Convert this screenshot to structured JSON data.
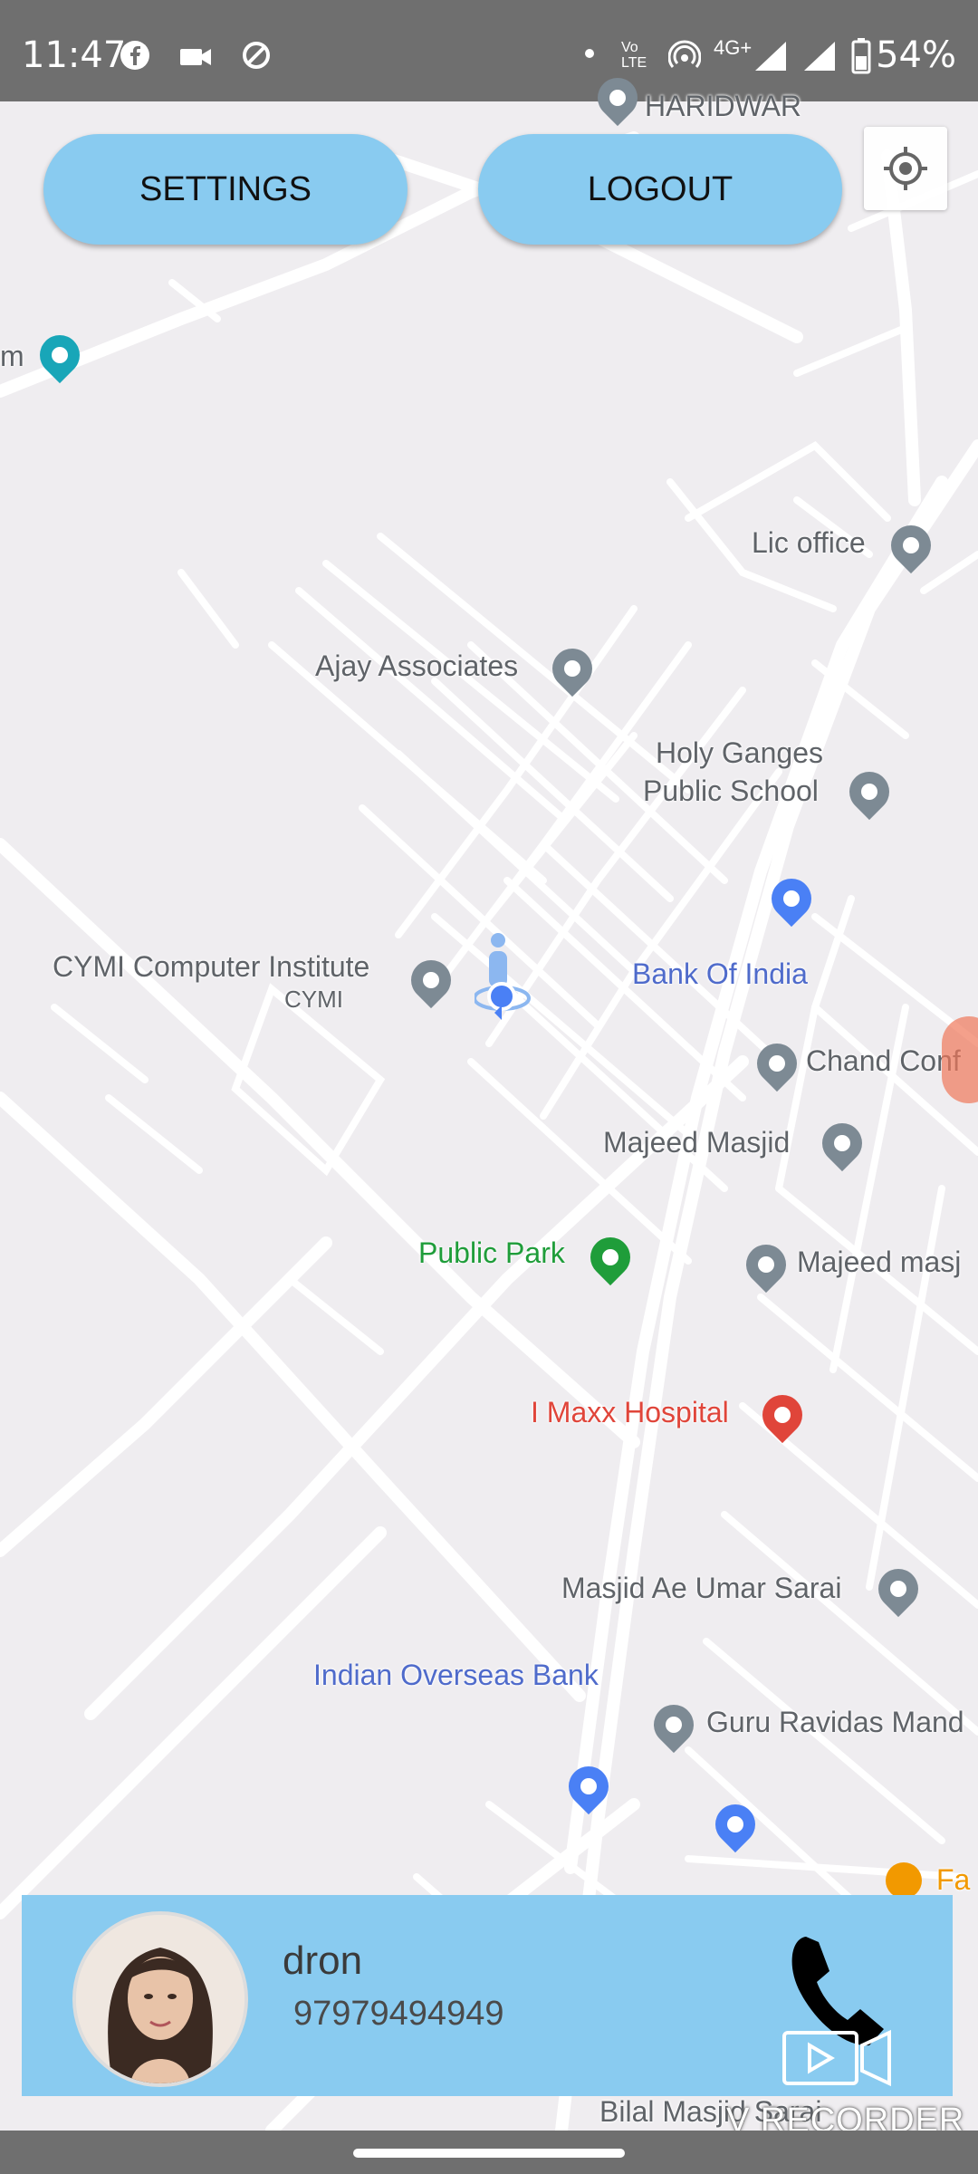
{
  "status_bar": {
    "time": "11:47",
    "battery": "54%",
    "network_label": "4G+",
    "volte_label": "Vo LTE",
    "icons": [
      "facebook-icon",
      "video-camera-icon",
      "location-off-icon",
      "dot-icon",
      "hotspot-icon",
      "signal-icon",
      "battery-icon"
    ]
  },
  "buttons": {
    "settings": "SETTINGS",
    "logout": "LOGOUT"
  },
  "map": {
    "labels": {
      "haridwar": "HARIDWAR",
      "m_partial": "m",
      "lic_office": "Lic office",
      "ajay_associates": "Ajay Associates",
      "holy_ganges_1": "Holy Ganges",
      "holy_ganges_2": "Public School",
      "cymi_institute": "CYMI Computer Institute",
      "cymi": "CYMI",
      "bank_of_india": "Bank Of India",
      "chand_conf": "Chand Conf",
      "majeed_masjid": "Majeed Masjid",
      "public_park": "Public Park",
      "majeed_masj": "Majeed masj",
      "imaxx_hospital": "I Maxx Hospital",
      "masjid_ae_umar": "Masjid Ae Umar Sarai",
      "indian_overseas": "Indian Overseas Bank",
      "guru_ravidas": "Guru Ravidas Mand",
      "fa_partial": "Fa",
      "bilal_masjid": "Bilal Masjid Sarai"
    },
    "colors": {
      "background": "#efedf0",
      "road": "#ffffff",
      "pin_gray": "#7d8a94",
      "pin_blue": "#4a80f5",
      "pin_green": "#1f9d3a",
      "pin_red": "#e0453a",
      "pin_orange": "#f29900",
      "pin_teal": "#18a6b8"
    }
  },
  "contact": {
    "name": "dron",
    "phone": "97979494949"
  },
  "watermark": {
    "text": "V RECORDER"
  },
  "theme": {
    "accent": "#89cbf0",
    "status_bar": "#6f6f6f"
  }
}
